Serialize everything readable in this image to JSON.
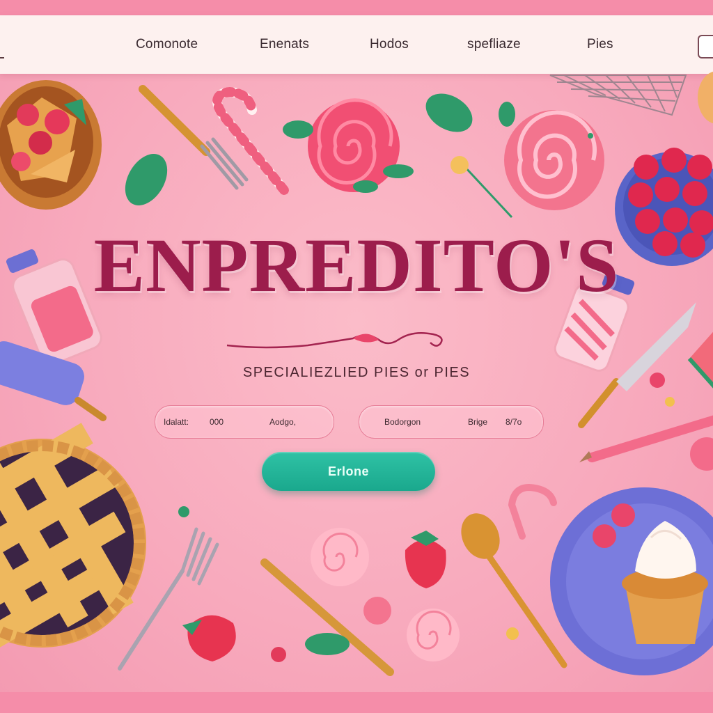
{
  "nav": {
    "items": [
      {
        "label": "Comonote"
      },
      {
        "label": "Enenats"
      },
      {
        "label": "Hodos"
      },
      {
        "label": "spefliaze"
      },
      {
        "label": "Pies"
      }
    ]
  },
  "hero": {
    "brand": "ENPREDITO'S",
    "tagline": "SPECIALIEZLIED PIES or PIES"
  },
  "form": {
    "field1": {
      "part1": "Idalatt:",
      "part2": "000",
      "part3": "Aodgo,"
    },
    "field2": {
      "part1": "Bodorgon",
      "part2": "Brige",
      "part3": "8/7o"
    }
  },
  "cta": {
    "label": "Erlone"
  },
  "colors": {
    "background": "#f8aabd",
    "nav_bg": "#fdf1ef",
    "title": "#9c1d4c",
    "cta": "#1fb496",
    "frame": "#f58da9"
  },
  "icons": [
    "pie-icon",
    "fork-icon",
    "candy-cane-icon",
    "lollipop-icon",
    "raspberry-bowl-icon",
    "jar-icon",
    "rolling-pin-icon",
    "knife-icon",
    "pencil-icon",
    "plate-icon",
    "cupcake-icon",
    "spoon-icon",
    "strawberry-icon",
    "leaf-icon"
  ]
}
